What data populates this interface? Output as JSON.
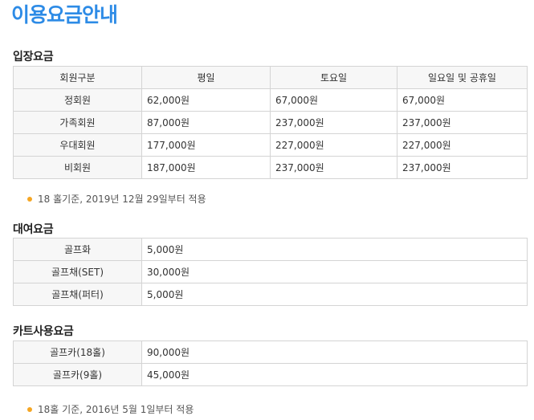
{
  "page": {
    "title": "이용요금안내"
  },
  "admission": {
    "title": "입장요금",
    "headers": [
      "회원구분",
      "평일",
      "토요일",
      "일요일 및 공휴일"
    ],
    "rows": [
      {
        "label": "정회원",
        "values": [
          "62,000원",
          "67,000원",
          "67,000원"
        ]
      },
      {
        "label": "가족회원",
        "values": [
          "87,000원",
          "237,000원",
          "237,000원"
        ]
      },
      {
        "label": "우대회원",
        "values": [
          "177,000원",
          "227,000원",
          "227,000원"
        ]
      },
      {
        "label": "비회원",
        "values": [
          "187,000원",
          "237,000원",
          "237,000원"
        ]
      }
    ],
    "note": "18 홀기준, 2019년 12월 29일부터 적용"
  },
  "rental": {
    "title": "대여요금",
    "rows": [
      {
        "label": "골프화",
        "value": "5,000원"
      },
      {
        "label": "골프채(SET)",
        "value": "30,000원"
      },
      {
        "label": "골프채(퍼터)",
        "value": "5,000원"
      }
    ]
  },
  "cart": {
    "title": "카트사용요금",
    "rows": [
      {
        "label": "골프카(18홀)",
        "value": "90,000원"
      },
      {
        "label": "골프카(9홀)",
        "value": "45,000원"
      }
    ],
    "note": "18홀 기준, 2016년 5월 1일부터 적용"
  },
  "colors": {
    "title": "#2d8be6",
    "bullet": "#f5a623",
    "border": "#d4d4d4",
    "header_bg": "#f7f7f7"
  }
}
